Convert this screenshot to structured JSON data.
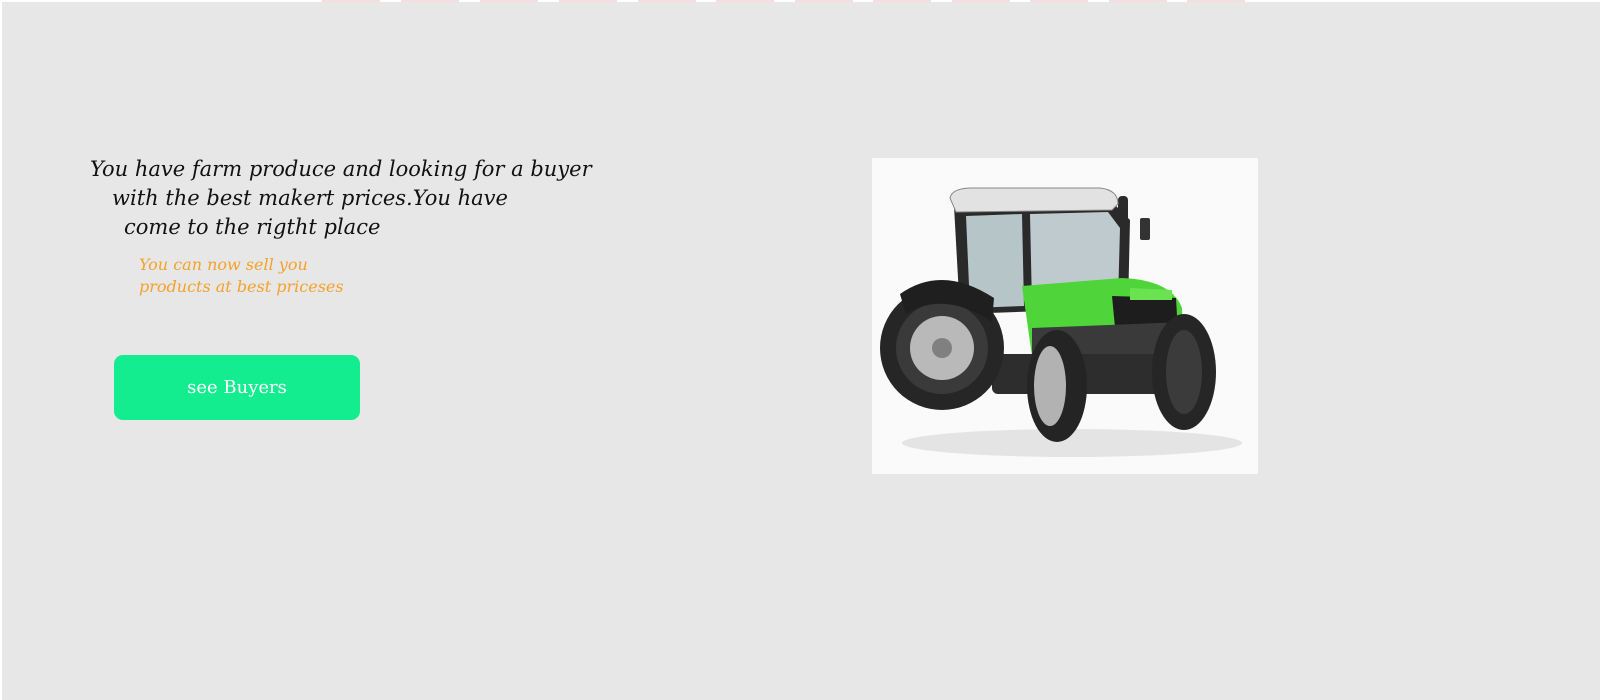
{
  "hero": {
    "headline_lines": [
      "You have  farm produce and looking for a buyer",
      "with the best makert prices.You have",
      "come to the rigtht place"
    ],
    "subtext_lines": [
      "You can now sell you",
      "products at best priceses"
    ],
    "cta_label": "see Buyers"
  },
  "image": {
    "icon": "tractor-image",
    "body_color": "#4fd43a"
  },
  "colors": {
    "background": "#e7e7e7",
    "headline": "#111111",
    "subtext": "#f5a12a",
    "button": "#13ec8f",
    "button_text": "#ffffff"
  }
}
